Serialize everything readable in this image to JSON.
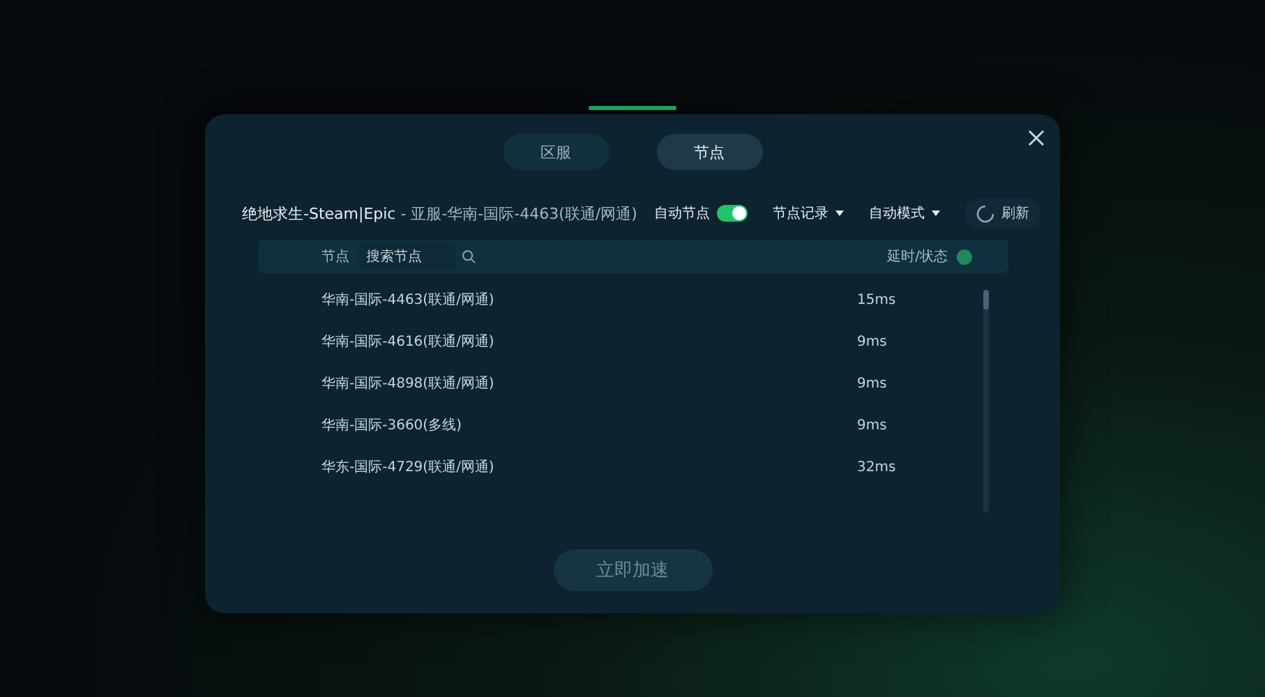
{
  "tabs": [
    {
      "label": "区服",
      "selected": false
    },
    {
      "label": "节点",
      "selected": true
    }
  ],
  "header": {
    "game": "绝地求生-Steam|Epic",
    "separator": " - ",
    "server": "亚服-华南-国际-4463(联通/网通)"
  },
  "auto_node": {
    "label": "自动节点",
    "on": true
  },
  "dropdowns": [
    {
      "label": "节点记录"
    },
    {
      "label": "自动模式"
    }
  ],
  "refresh_button": {
    "label": "刷新"
  },
  "table": {
    "columns": {
      "node": "节点",
      "search_placeholder": "搜索节点",
      "latency": "延时/状态"
    },
    "rows": [
      {
        "name": "华南-国际-4463(联通/网通)",
        "latency": "15ms"
      },
      {
        "name": "华南-国际-4616(联通/网通)",
        "latency": "9ms"
      },
      {
        "name": "华南-国际-4898(联通/网通)",
        "latency": "9ms"
      },
      {
        "name": "华南-国际-3660(多线)",
        "latency": "9ms"
      },
      {
        "name": "华东-国际-4729(联通/网通)",
        "latency": "32ms"
      }
    ]
  },
  "accelerate_button": {
    "label": "立即加速",
    "disabled": true
  }
}
